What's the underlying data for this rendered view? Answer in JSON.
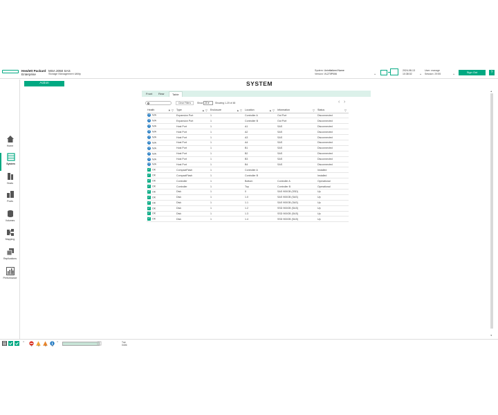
{
  "header": {
    "brand_line1": "Hewlett Packard",
    "brand_line2": "Enterprise",
    "product": "MSA 2050 SAS",
    "product_sub": "Storage Management Utility",
    "system_label": "System:",
    "system_value": "Uninitialized Name",
    "version_label": "Version:",
    "version_value": "VL270P006",
    "date": "2024-08-13",
    "time": "10:38:02",
    "user_label": "User:",
    "user_value": "manage",
    "session_label": "Session:",
    "session_value": "29:55",
    "sign_out": "Sign Out",
    "help": "?"
  },
  "sidebar": {
    "items": [
      {
        "label": "Home"
      },
      {
        "label": "System"
      },
      {
        "label": "Hosts"
      },
      {
        "label": "Pools"
      },
      {
        "label": "Volumes"
      },
      {
        "label": "Mapping"
      },
      {
        "label": "Replications"
      },
      {
        "label": "Performance"
      }
    ]
  },
  "toolbar": {
    "action": "Action"
  },
  "page": {
    "title": "SYSTEM"
  },
  "tabs": [
    {
      "label": "Front",
      "active": false
    },
    {
      "label": "Rear",
      "active": false
    },
    {
      "label": "Table",
      "active": true
    }
  ],
  "filters": {
    "clear": "Clear Filters",
    "show_label": "Show",
    "show_value": "20",
    "showing": "Showing 1-20 of 48"
  },
  "table": {
    "columns": [
      "Health",
      "Type",
      "Enclosure",
      "Location",
      "Information",
      "Status"
    ],
    "rows": [
      {
        "health_icon": "info",
        "health": "N/A",
        "type": "Expansion Port",
        "enclosure": "1",
        "location": "Controller A",
        "information": "Out Port",
        "status": "Disconnected"
      },
      {
        "health_icon": "info",
        "health": "N/A",
        "type": "Expansion Port",
        "enclosure": "1",
        "location": "Controller B",
        "information": "Out Port",
        "status": "Disconnected"
      },
      {
        "health_icon": "info",
        "health": "N/A",
        "type": "Host Port",
        "enclosure": "1",
        "location": "A1",
        "information": "SAS",
        "status": "Disconnected"
      },
      {
        "health_icon": "info",
        "health": "N/A",
        "type": "Host Port",
        "enclosure": "1",
        "location": "A2",
        "information": "SAS",
        "status": "Disconnected"
      },
      {
        "health_icon": "info",
        "health": "N/A",
        "type": "Host Port",
        "enclosure": "1",
        "location": "A3",
        "information": "SAS",
        "status": "Disconnected"
      },
      {
        "health_icon": "info",
        "health": "N/A",
        "type": "Host Port",
        "enclosure": "1",
        "location": "A4",
        "information": "SAS",
        "status": "Disconnected"
      },
      {
        "health_icon": "info",
        "health": "N/A",
        "type": "Host Port",
        "enclosure": "1",
        "location": "B1",
        "information": "SAS",
        "status": "Disconnected"
      },
      {
        "health_icon": "info",
        "health": "N/A",
        "type": "Host Port",
        "enclosure": "1",
        "location": "B2",
        "information": "SAS",
        "status": "Disconnected"
      },
      {
        "health_icon": "info",
        "health": "N/A",
        "type": "Host Port",
        "enclosure": "1",
        "location": "B3",
        "information": "SAS",
        "status": "Disconnected"
      },
      {
        "health_icon": "info",
        "health": "N/A",
        "type": "Host Port",
        "enclosure": "1",
        "location": "B4",
        "information": "SAS",
        "status": "Disconnected"
      },
      {
        "health_icon": "ok",
        "health": "OK",
        "type": "CompactFlash",
        "enclosure": "1",
        "location": "Controller A",
        "information": "",
        "status": "Installed"
      },
      {
        "health_icon": "ok",
        "health": "OK",
        "type": "CompactFlash",
        "enclosure": "1",
        "location": "Controller B",
        "information": "",
        "status": "Installed"
      },
      {
        "health_icon": "ok",
        "health": "OK",
        "type": "Controller",
        "enclosure": "1",
        "location": "Bottom",
        "information": "Controller A",
        "status": "Operational"
      },
      {
        "health_icon": "ok",
        "health": "OK",
        "type": "Controller",
        "enclosure": "1",
        "location": "Top",
        "information": "Controller B",
        "status": "Operational"
      },
      {
        "health_icon": "ok",
        "health": "OK",
        "type": "Disk",
        "enclosure": "1",
        "location": "0",
        "information": "SAS 900GB (SSD)",
        "status": "Up"
      },
      {
        "health_icon": "ok",
        "health": "OK",
        "type": "Disk",
        "enclosure": "1",
        "location": "1.0",
        "information": "SAS 900GB (SAS)",
        "status": "Up"
      },
      {
        "health_icon": "ok",
        "health": "OK",
        "type": "Disk",
        "enclosure": "1",
        "location": "1.1",
        "information": "SAS 900GB (SAS)",
        "status": "Up"
      },
      {
        "health_icon": "ok",
        "health": "OK",
        "type": "Disk",
        "enclosure": "1",
        "location": "1.2",
        "information": "SSD 900GB (SAS)",
        "status": "Up"
      },
      {
        "health_icon": "ok",
        "health": "OK",
        "type": "Disk",
        "enclosure": "1",
        "location": "1.3",
        "information": "SSD 900GB (SAS)",
        "status": "Up"
      },
      {
        "health_icon": "ok",
        "health": "OK",
        "type": "Disk",
        "enclosure": "1",
        "location": "1.4",
        "information": "SSD 900GB (SAS)",
        "status": "Up"
      }
    ]
  },
  "statusbar": {
    "counts": [
      "1",
      "0",
      "0",
      "0"
    ],
    "progress_fraction": 1.0,
    "date_line1": "Tue",
    "date_line2": "0406"
  },
  "colors": {
    "accent": "#01a982",
    "info": "#2a7fc4",
    "error": "#d9372b",
    "warning": "#f1a534"
  }
}
